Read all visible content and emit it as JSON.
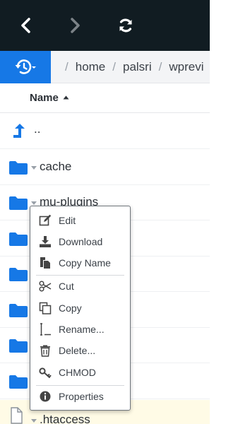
{
  "toolbar": {
    "back_icon": "chevron-left-icon",
    "forward_icon": "chevron-right-icon",
    "refresh_icon": "refresh-icon",
    "colors": {
      "background": "#111c22",
      "icon": "#ffffff",
      "disabled_icon": "#7c8388"
    }
  },
  "breadcrumb": {
    "history_icon": "history-icon",
    "items": [
      "home",
      "palsri",
      "wprevi"
    ],
    "accent": "#1678e6"
  },
  "columns": {
    "name_label": "Name",
    "sort_direction": "ascending"
  },
  "files": [
    {
      "label": "..",
      "type": "parent-dir"
    },
    {
      "label": "cache",
      "type": "folder"
    },
    {
      "label": "mu-plugins",
      "type": "folder"
    },
    {
      "label": "",
      "type": "folder"
    },
    {
      "label": "",
      "type": "folder"
    },
    {
      "label": "",
      "type": "folder"
    },
    {
      "label": "",
      "type": "folder"
    },
    {
      "label": "",
      "type": "folder"
    },
    {
      "label": ".htaccess",
      "type": "file"
    }
  ],
  "context_menu": {
    "groups": [
      [
        {
          "label": "Edit",
          "icon": "edit-icon"
        },
        {
          "label": "Download",
          "icon": "download-icon"
        },
        {
          "label": "Copy Name",
          "icon": "copy-name-icon"
        }
      ],
      [
        {
          "label": "Cut",
          "icon": "scissors-icon"
        },
        {
          "label": "Copy",
          "icon": "copy-icon"
        },
        {
          "label": "Rename...",
          "icon": "text-cursor-icon"
        },
        {
          "label": "Delete...",
          "icon": "trash-icon"
        },
        {
          "label": "CHMOD",
          "icon": "key-icon"
        }
      ],
      [
        {
          "label": "Properties",
          "icon": "info-icon"
        }
      ]
    ]
  }
}
